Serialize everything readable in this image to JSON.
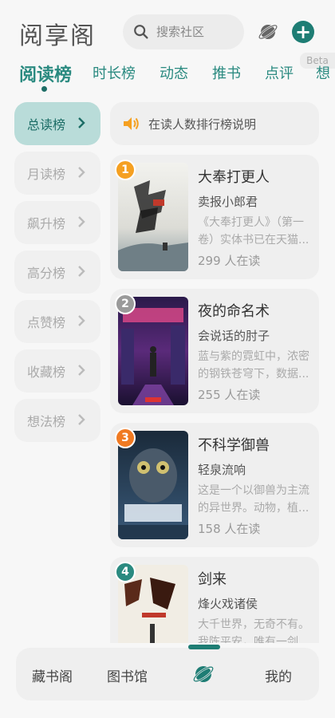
{
  "header": {
    "title": "阅享阁",
    "search_placeholder": "搜索社区",
    "beta_label": "Beta"
  },
  "tabs": [
    {
      "label": "阅读榜",
      "active": true
    },
    {
      "label": "时长榜",
      "active": false
    },
    {
      "label": "动态",
      "active": false
    },
    {
      "label": "推书",
      "active": false
    },
    {
      "label": "点评",
      "active": false
    },
    {
      "label": "想",
      "active": false
    }
  ],
  "sidebar": {
    "items": [
      {
        "label": "总读榜",
        "active": true
      },
      {
        "label": "月读榜",
        "active": false
      },
      {
        "label": "飙升榜",
        "active": false
      },
      {
        "label": "高分榜",
        "active": false
      },
      {
        "label": "点赞榜",
        "active": false
      },
      {
        "label": "收藏榜",
        "active": false
      },
      {
        "label": "想法榜",
        "active": false
      }
    ]
  },
  "notice": {
    "text": "在读人数排行榜说明"
  },
  "books": [
    {
      "rank": "1",
      "title": "大奉打更人",
      "author": "卖报小郎君",
      "desc": "《大奉打更人》（第一卷）实体书已在天猫...",
      "readers": "299 人在读",
      "rank_color": "#f5a021"
    },
    {
      "rank": "2",
      "title": "夜的命名术",
      "author": "会说话的肘子",
      "desc": "蓝与紫的霓虹中，浓密的钢铁苍穹下，数据...",
      "readers": "255 人在读",
      "rank_color": "#9a9a9a"
    },
    {
      "rank": "3",
      "title": "不科学御兽",
      "author": "轻泉流响",
      "desc": "这是一个以御兽为主流的异世界。动物，植...",
      "readers": "158 人在读",
      "rank_color": "#f07a22"
    },
    {
      "rank": "4",
      "title": "剑来",
      "author": "烽火戏诸侯",
      "desc": "大千世界，无奇不有。我陈平安，唯有一剑...",
      "readers": "",
      "rank_color": "#2a8a80"
    }
  ],
  "bottom_nav": {
    "items": [
      {
        "label": "藏书阁"
      },
      {
        "label": "图书馆"
      },
      {
        "label": ""
      },
      {
        "label": "我的"
      }
    ]
  },
  "colors": {
    "accent": "#1e7d74",
    "active_side_bg": "#b9dcd9"
  }
}
